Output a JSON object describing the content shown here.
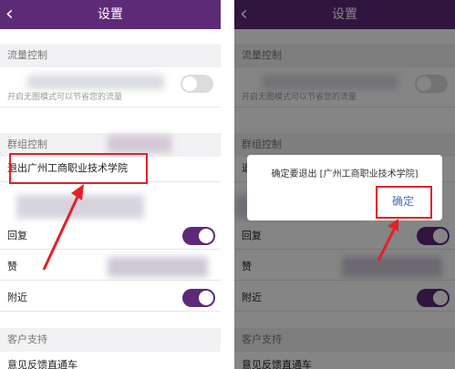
{
  "header": {
    "back_glyph": "‹",
    "title": "设置"
  },
  "sections": {
    "traffic": "流量控制",
    "group": "群组控制",
    "support": "客户支持"
  },
  "rows": {
    "traffic_sub": "开启无图模式可以节省您的流量",
    "exit_group": "退出广州工商职业技术学院",
    "reply": "回复",
    "like": "赞",
    "nearby": "附近",
    "feedback": "意见反馈直通车"
  },
  "dialog": {
    "message": "确定要退出 [广州工商职业技术学院]",
    "confirm_label": "确定"
  },
  "colors": {
    "accent": "#5d2a78",
    "highlight": "#e52026",
    "link": "#3d6fc2"
  },
  "toggles": {
    "traffic_on": false,
    "reply_on": true,
    "like_on": true,
    "nearby_on": true
  }
}
